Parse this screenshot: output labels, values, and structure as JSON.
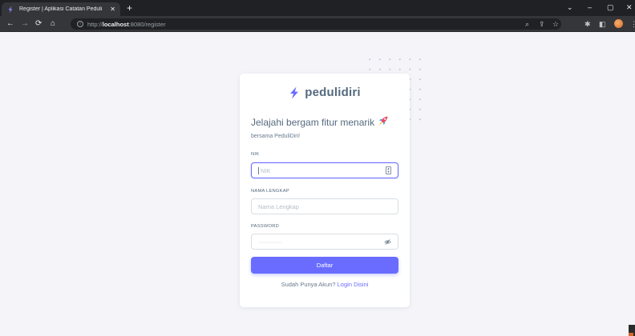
{
  "browser": {
    "tab_title": "Register | Aplikasi Catatan Peduli",
    "tab_close": "✕",
    "new_tab": "+",
    "url_prefix": "http://",
    "url_host": "localhost",
    "url_path": ":8080/register",
    "icons": [
      "back-icon",
      "forward-icon",
      "reload-icon",
      "home-icon",
      "zoom-icon",
      "share-icon",
      "bookmark-star-icon",
      "extensions-icon",
      "sidebar-icon",
      "profile-avatar",
      "menu-icon"
    ]
  },
  "brand": {
    "name": "pedulidiri",
    "color": "#696cff"
  },
  "welcome": {
    "title": "Jelajahi bergam fitur menarik",
    "subtitle": "bersama PeduliDiri!"
  },
  "form": {
    "nik_label": "NIK",
    "nik_placeholder": "NIK",
    "nama_label": "NAMA LENGKAP",
    "nama_placeholder": "Nama Lengkap",
    "password_label": "PASSWORD",
    "password_placeholder": "············",
    "submit_label": "Daftar"
  },
  "footer": {
    "text": "Sudah Punya Akun?",
    "link": "Login Disini"
  },
  "colors": {
    "primary": "#696cff",
    "background": "#f5f5f9",
    "heading": "#566a7f"
  }
}
